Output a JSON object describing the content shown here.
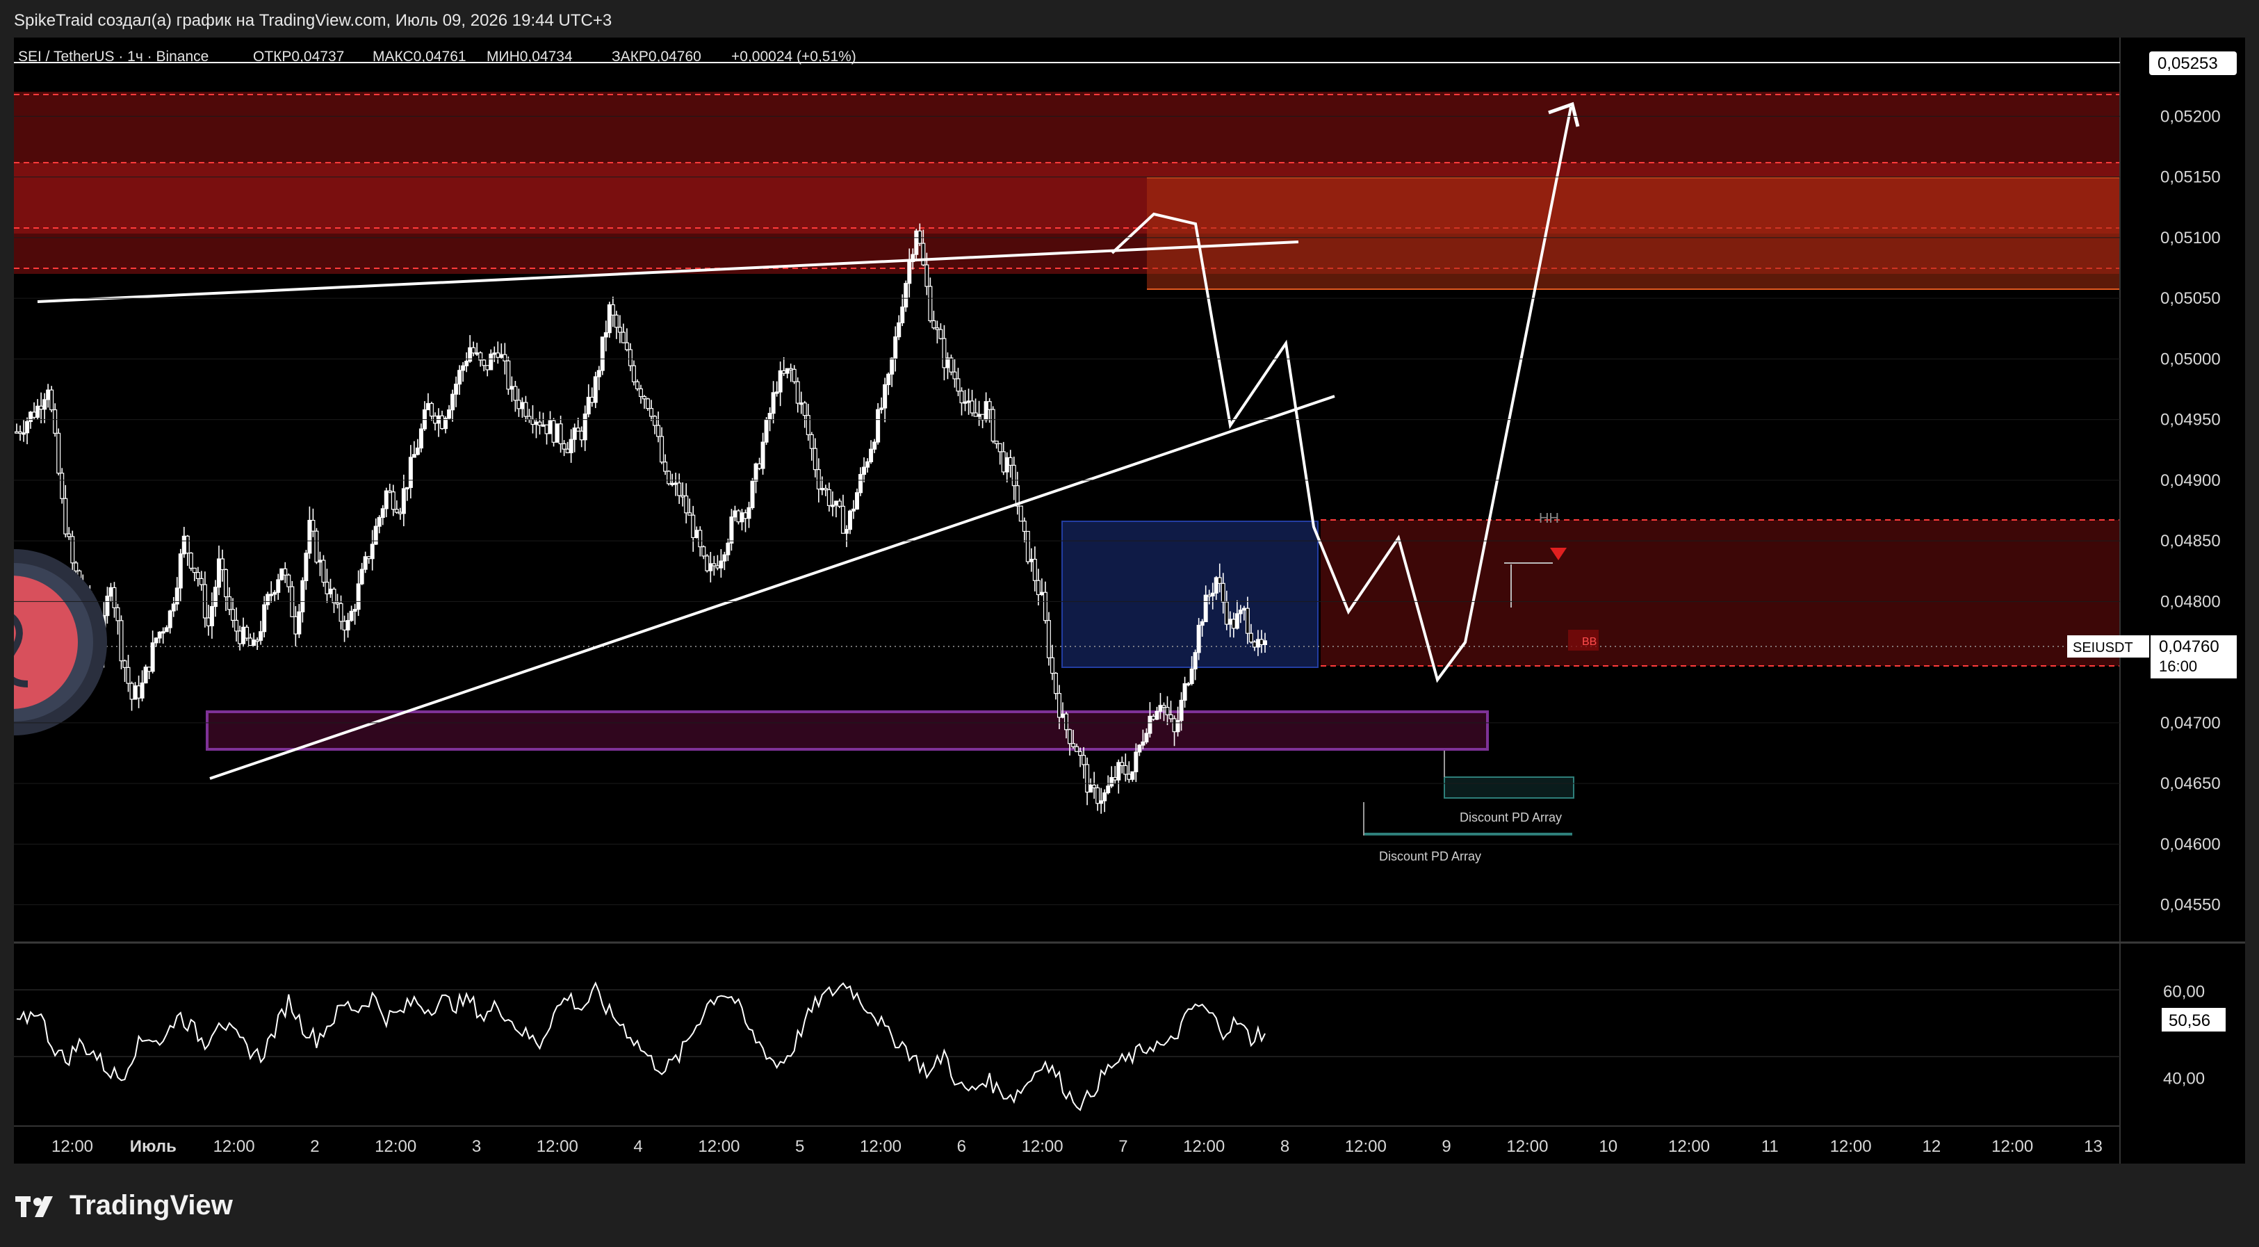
{
  "header": {
    "credit": "SpikeTraid создал(а) график на TradingView.com, Июль 09, 2026 19:44 UTC+3"
  },
  "legend": {
    "symbol": "SEI / TetherUS · 1ч · Binance",
    "open": "ОТКР0,04737",
    "high": "МАКС0,04761",
    "low": "МИН0,04734",
    "close": "ЗАКР0,04760",
    "change": "+0,00024 (+0,51%)"
  },
  "price_axis": {
    "top_value": "0,05253",
    "current_symbol": "SEIUSDT",
    "current_price": "0,04760",
    "current_time": "16:00",
    "ticks": [
      "0,05200",
      "0,05150",
      "0,05100",
      "0,05050",
      "0,05000",
      "0,04950",
      "0,04900",
      "0,04850",
      "0,04800",
      "0,04700",
      "0,04650",
      "0,04600",
      "0,04550"
    ],
    "rsi_ticks": [
      "60,00",
      "40,00"
    ],
    "rsi_value": "50,56"
  },
  "time_axis": {
    "labels": [
      "12:00",
      "Июль",
      "12:00",
      "2",
      "12:00",
      "3",
      "12:00",
      "4",
      "12:00",
      "5",
      "12:00",
      "6",
      "12:00",
      "7",
      "12:00",
      "8",
      "12:00",
      "9",
      "12:00",
      "10",
      "12:00",
      "11",
      "12:00",
      "12",
      "12:00",
      "13"
    ]
  },
  "annotations": {
    "hh": "HH",
    "bb": "BB",
    "discount_1": "Discount PD Array",
    "discount_2": "Discount PD Array"
  },
  "colors": {
    "background": "#000000",
    "up_candle": "#ffffff",
    "down_candle": "#ffffff",
    "resistance_zone": "#b31414",
    "supply_zone": "#a82a10",
    "demand_box": "#1a2a6e",
    "purple_zone": "#b445d6",
    "lines": "#ffffff"
  },
  "footer": {
    "brand": "TradingView"
  },
  "chart_data": {
    "type": "candlestick",
    "symbol": "SEI / TetherUS",
    "interval": "1ч",
    "exchange": "Binance",
    "ylim": [
      0.0452,
      0.05265
    ],
    "rsi_ylim": [
      30,
      70
    ],
    "x": [
      0,
      1,
      2,
      3,
      4,
      5,
      6,
      7,
      8,
      9,
      10,
      11,
      12,
      13,
      14,
      15,
      16,
      17,
      18,
      19,
      20,
      21,
      22,
      23,
      24,
      25,
      26,
      27,
      28,
      29,
      30,
      31,
      32,
      33,
      34,
      35,
      36,
      37,
      38,
      39,
      40,
      41,
      42,
      43,
      44,
      45,
      46,
      47,
      48,
      49,
      50,
      51,
      52,
      53,
      54,
      55,
      56,
      57,
      58,
      59,
      60,
      61,
      62,
      63,
      64,
      65,
      66,
      67,
      68,
      69,
      70,
      71,
      72,
      73,
      74,
      75,
      76,
      77,
      78,
      79,
      80,
      81,
      82,
      83,
      84,
      85,
      86,
      87,
      88,
      89,
      90,
      91,
      92,
      93,
      94,
      95,
      96,
      97,
      98,
      99,
      100,
      101,
      102,
      103,
      104,
      105,
      106,
      107,
      108,
      109,
      110,
      111,
      112,
      113,
      114,
      115,
      116,
      117,
      118,
      119,
      120,
      121,
      122,
      123,
      124,
      125,
      126,
      127,
      128,
      129,
      130,
      131,
      132,
      133,
      134,
      135,
      136,
      137,
      138,
      139,
      140,
      141,
      142,
      143,
      144,
      145,
      146,
      147,
      148,
      149,
      150,
      151,
      152,
      153,
      154,
      155,
      156,
      157,
      158,
      159,
      160,
      161,
      162,
      163,
      164,
      165,
      166,
      167,
      168,
      169,
      170,
      171,
      172,
      173,
      174,
      175,
      176,
      177,
      178,
      179,
      180,
      181,
      182,
      183,
      184,
      185,
      186,
      187,
      188,
      189,
      190,
      191,
      192,
      193,
      194,
      195,
      196,
      197,
      198,
      199,
      200,
      201,
      202,
      203,
      204,
      205,
      206,
      207,
      208,
      209,
      210,
      211,
      212,
      213,
      214,
      215,
      216,
      217,
      218,
      219,
      220,
      221,
      222,
      223,
      224,
      225,
      226,
      227,
      228,
      229,
      230,
      231,
      232,
      233,
      234,
      235,
      236,
      237,
      238,
      239,
      240,
      241,
      242,
      243,
      244,
      245,
      246,
      247,
      248,
      249,
      250,
      251,
      252,
      253,
      254,
      255,
      256,
      257,
      258,
      259,
      260,
      261,
      262,
      263,
      264,
      265,
      266,
      267,
      268,
      269,
      270,
      271,
      272,
      273,
      274,
      275,
      276,
      277,
      278,
      279,
      280,
      281,
      282,
      283,
      284,
      285,
      286,
      287,
      288,
      289,
      290,
      291,
      292,
      293,
      294,
      295,
      296,
      297,
      298,
      299,
      300,
      301,
      302,
      303,
      304,
      305,
      306,
      307,
      308,
      309,
      310,
      311,
      312,
      313,
      314,
      315,
      316,
      317,
      318,
      319,
      320,
      321,
      322,
      323,
      324,
      325,
      326,
      327,
      328,
      329,
      330,
      331,
      332,
      333,
      334,
      335,
      336,
      337,
      338,
      339,
      340,
      341,
      342,
      343,
      344,
      345,
      346,
      347,
      348,
      349,
      350,
      351,
      352,
      353,
      354,
      355,
      356,
      357,
      358,
      359,
      360,
      361,
      362,
      363,
      364,
      365,
      366,
      367,
      368,
      369,
      370,
      371,
      372,
      373,
      374,
      375,
      376,
      377,
      378,
      379,
      380,
      381,
      382,
      383,
      384,
      385,
      386,
      387,
      388,
      389,
      390,
      391,
      392,
      393,
      394,
      395,
      396,
      397,
      398,
      399,
      400,
      401,
      402,
      403,
      404,
      405,
      406,
      407,
      408,
      409,
      410,
      411,
      412,
      413,
      414,
      415,
      416,
      417,
      418,
      419,
      420,
      421,
      422,
      423,
      424,
      425,
      426,
      427,
      428,
      429,
      430,
      431,
      432,
      433,
      434,
      435,
      436,
      437,
      438,
      439,
      440,
      441,
      442,
      443,
      444,
      445,
      446,
      447,
      448,
      449,
      450,
      451,
      452,
      453,
      454,
      455,
      456,
      457,
      458,
      459,
      460,
      461,
      462,
      463,
      464,
      465,
      466,
      467,
      468,
      469,
      470,
      471,
      472,
      473,
      474,
      475,
      476,
      477,
      478,
      479,
      480,
      481,
      482,
      483,
      484,
      485,
      486,
      487,
      488,
      489,
      490,
      491,
      492,
      493,
      494,
      495,
      496,
      497,
      498,
      499,
      500,
      501,
      502,
      503,
      504,
      505,
      506,
      507,
      508,
      509,
      510,
      511,
      512,
      513,
      514,
      515,
      516,
      517,
      518,
      519,
      520,
      521,
      522,
      523,
      524,
      525,
      526,
      527,
      528,
      529,
      530,
      531,
      532,
      533,
      534,
      535,
      536,
      537,
      538,
      539,
      540,
      541,
      542,
      543,
      544,
      545,
      546,
      547,
      548,
      549,
      550,
      551,
      552,
      553,
      554,
      555,
      556,
      557,
      558,
      559,
      560,
      561,
      562,
      563,
      564,
      565,
      566,
      567,
      568,
      569,
      570,
      571,
      572,
      573,
      574,
      575,
      576,
      577,
      578,
      579,
      580,
      581,
      582,
      583,
      584,
      585,
      586,
      587,
      588,
      589,
      590,
      591,
      592,
      593,
      594,
      595,
      596,
      597,
      598,
      599
    ],
    "path": [
      [
        0,
        0.0494
      ],
      [
        6,
        0.0496
      ],
      [
        9,
        0.0498
      ],
      [
        13,
        0.0488
      ],
      [
        16,
        0.0483
      ],
      [
        20,
        0.048
      ],
      [
        24,
        0.0476
      ],
      [
        27,
        0.0482
      ],
      [
        30,
        0.0476
      ],
      [
        33,
        0.0472
      ],
      [
        36,
        0.0473
      ],
      [
        40,
        0.0477
      ],
      [
        44,
        0.0479
      ],
      [
        48,
        0.0485
      ],
      [
        52,
        0.0482
      ],
      [
        55,
        0.0478
      ],
      [
        58,
        0.0483
      ],
      [
        62,
        0.0478
      ],
      [
        65,
        0.0477
      ],
      [
        68,
        0.0476
      ],
      [
        72,
        0.048
      ],
      [
        76,
        0.0483
      ],
      [
        80,
        0.0478
      ],
      [
        84,
        0.0486
      ],
      [
        88,
        0.0482
      ],
      [
        92,
        0.0479
      ],
      [
        95,
        0.0478
      ],
      [
        98,
        0.0481
      ],
      [
        102,
        0.0485
      ],
      [
        106,
        0.0489
      ],
      [
        110,
        0.0488
      ],
      [
        114,
        0.0492
      ],
      [
        118,
        0.0496
      ],
      [
        122,
        0.0495
      ],
      [
        126,
        0.0498
      ],
      [
        130,
        0.0501
      ],
      [
        134,
        0.0499
      ],
      [
        138,
        0.0501
      ],
      [
        142,
        0.0497
      ],
      [
        146,
        0.0496
      ],
      [
        150,
        0.0495
      ],
      [
        154,
        0.0494
      ],
      [
        158,
        0.0493
      ],
      [
        162,
        0.0494
      ],
      [
        166,
        0.0498
      ],
      [
        170,
        0.0504
      ],
      [
        174,
        0.0501
      ],
      [
        178,
        0.0498
      ],
      [
        182,
        0.0496
      ],
      [
        186,
        0.049
      ],
      [
        190,
        0.0489
      ],
      [
        194,
        0.0486
      ],
      [
        198,
        0.0482
      ],
      [
        202,
        0.0484
      ],
      [
        206,
        0.0487
      ],
      [
        210,
        0.0488
      ],
      [
        214,
        0.0493
      ],
      [
        218,
        0.0498
      ],
      [
        222,
        0.0499
      ],
      [
        226,
        0.0495
      ],
      [
        230,
        0.049
      ],
      [
        234,
        0.0488
      ],
      [
        238,
        0.0486
      ],
      [
        242,
        0.049
      ],
      [
        246,
        0.0494
      ],
      [
        250,
        0.0498
      ],
      [
        254,
        0.0505
      ],
      [
        258,
        0.0511
      ],
      [
        262,
        0.0504
      ],
      [
        266,
        0.05
      ],
      [
        270,
        0.0498
      ],
      [
        274,
        0.0495
      ],
      [
        278,
        0.0496
      ],
      [
        282,
        0.0492
      ],
      [
        286,
        0.049
      ],
      [
        288,
        0.0486
      ],
      [
        292,
        0.0482
      ],
      [
        294,
        0.048
      ],
      [
        297,
        0.0474
      ],
      [
        300,
        0.047
      ],
      [
        304,
        0.0468
      ],
      [
        308,
        0.0464
      ],
      [
        312,
        0.0464
      ],
      [
        316,
        0.0466
      ],
      [
        320,
        0.0466
      ],
      [
        324,
        0.047
      ],
      [
        328,
        0.0472
      ],
      [
        332,
        0.0469
      ],
      [
        336,
        0.0474
      ],
      [
        340,
        0.0479
      ],
      [
        344,
        0.0482
      ],
      [
        348,
        0.0478
      ],
      [
        352,
        0.0479
      ],
      [
        356,
        0.0476
      ],
      [
        358,
        0.0476
      ]
    ],
    "rsi_path": [
      [
        0,
        52
      ],
      [
        6,
        56
      ],
      [
        10,
        48
      ],
      [
        14,
        44
      ],
      [
        18,
        48
      ],
      [
        22,
        46
      ],
      [
        26,
        42
      ],
      [
        30,
        40
      ],
      [
        34,
        47
      ],
      [
        38,
        50
      ],
      [
        42,
        48
      ],
      [
        46,
        55
      ],
      [
        50,
        52
      ],
      [
        54,
        48
      ],
      [
        58,
        54
      ],
      [
        62,
        50
      ],
      [
        66,
        47
      ],
      [
        70,
        45
      ],
      [
        74,
        51
      ],
      [
        78,
        58
      ],
      [
        82,
        52
      ],
      [
        86,
        49
      ],
      [
        90,
        53
      ],
      [
        94,
        57
      ],
      [
        98,
        56
      ],
      [
        102,
        59
      ],
      [
        106,
        54
      ],
      [
        110,
        55
      ],
      [
        114,
        58
      ],
      [
        118,
        56
      ],
      [
        122,
        58
      ],
      [
        126,
        57
      ],
      [
        130,
        58
      ],
      [
        134,
        54
      ],
      [
        138,
        57
      ],
      [
        142,
        53
      ],
      [
        146,
        50
      ],
      [
        150,
        48
      ],
      [
        154,
        55
      ],
      [
        158,
        59
      ],
      [
        162,
        56
      ],
      [
        166,
        60
      ],
      [
        170,
        55
      ],
      [
        174,
        52
      ],
      [
        178,
        48
      ],
      [
        182,
        44
      ],
      [
        186,
        42
      ],
      [
        190,
        45
      ],
      [
        194,
        51
      ],
      [
        198,
        57
      ],
      [
        202,
        60
      ],
      [
        206,
        58
      ],
      [
        210,
        51
      ],
      [
        214,
        47
      ],
      [
        218,
        43
      ],
      [
        222,
        46
      ],
      [
        226,
        53
      ],
      [
        230,
        58
      ],
      [
        234,
        60
      ],
      [
        238,
        62
      ],
      [
        242,
        58
      ],
      [
        246,
        55
      ],
      [
        250,
        50
      ],
      [
        254,
        48
      ],
      [
        258,
        44
      ],
      [
        262,
        41
      ],
      [
        266,
        46
      ],
      [
        270,
        38
      ],
      [
        274,
        37
      ],
      [
        278,
        40
      ],
      [
        282,
        37
      ],
      [
        286,
        36
      ],
      [
        290,
        39
      ],
      [
        294,
        44
      ],
      [
        298,
        41
      ],
      [
        302,
        36
      ],
      [
        306,
        34
      ],
      [
        310,
        39
      ],
      [
        314,
        43
      ],
      [
        318,
        44
      ],
      [
        322,
        46
      ],
      [
        326,
        48
      ],
      [
        330,
        47
      ],
      [
        334,
        52
      ],
      [
        338,
        57
      ],
      [
        342,
        55
      ],
      [
        346,
        51
      ],
      [
        350,
        53
      ],
      [
        354,
        49
      ],
      [
        356,
        50.5
      ]
    ]
  }
}
